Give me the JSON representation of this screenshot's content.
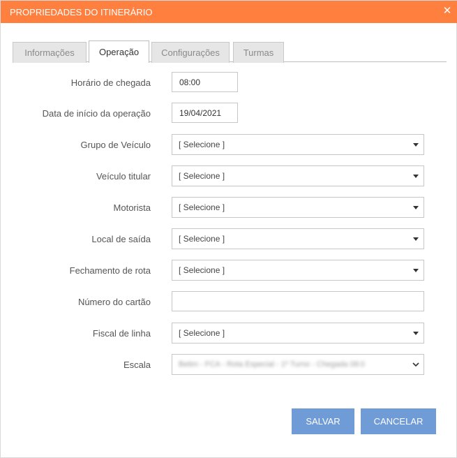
{
  "dialog": {
    "title": "PROPRIEDADES DO ITINERÁRIO",
    "close_icon": "close-icon"
  },
  "tabs": [
    {
      "label": "Informações",
      "active": false
    },
    {
      "label": "Operação",
      "active": true
    },
    {
      "label": "Configurações",
      "active": false
    },
    {
      "label": "Turmas",
      "active": false
    }
  ],
  "fields": {
    "arrival_time": {
      "label": "Horário de chegada",
      "value": "08:00"
    },
    "start_date": {
      "label": "Data de início da operação",
      "value": "19/04/2021"
    },
    "vehicle_group": {
      "label": "Grupo de Veículo",
      "value": "[ Selecione ]"
    },
    "vehicle": {
      "label": "Veículo titular",
      "value": "[ Selecione ]"
    },
    "driver": {
      "label": "Motorista",
      "value": "[ Selecione ]"
    },
    "departure_place": {
      "label": "Local de saída",
      "value": "[ Selecione ]"
    },
    "route_closing": {
      "label": "Fechamento de rota",
      "value": "[ Selecione ]"
    },
    "card_number": {
      "label": "Número do cartão",
      "value": ""
    },
    "inspector": {
      "label": "Fiscal de linha",
      "value": "[ Selecione ]"
    },
    "schedule": {
      "label": "Escala",
      "value": "Betim - FCA - Rota Especial - 1º Turno - Chegada 08:0"
    }
  },
  "buttons": {
    "save": "SALVAR",
    "cancel": "CANCELAR"
  },
  "colors": {
    "titlebar": "#ff7f3f",
    "button": "#6f9bd6"
  }
}
